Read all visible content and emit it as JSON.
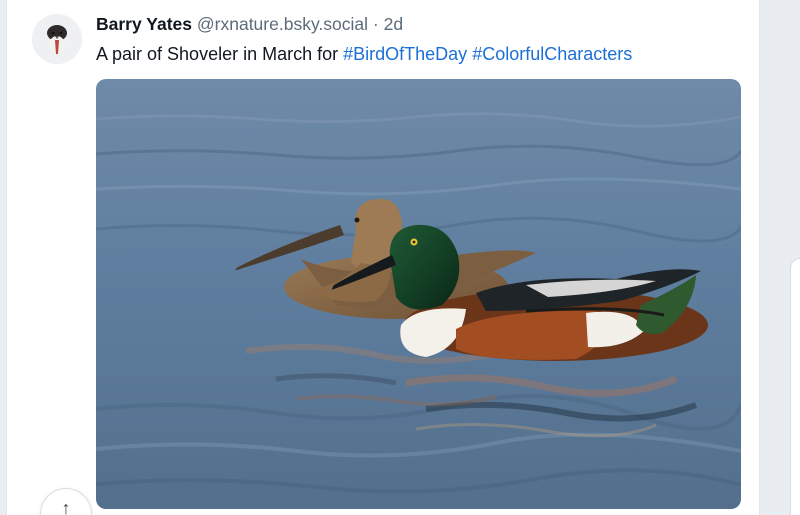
{
  "post": {
    "author_name": "Barry Yates",
    "author_handle": "@rxnature.bsky.social",
    "separator": "·",
    "time": "2d",
    "text": "A pair of Shoveler in March for ",
    "hashtags": [
      "#BirdOfTheDay",
      "#ColorfulCharacters"
    ]
  },
  "icons": {
    "avatar": "bird-avatar-icon",
    "reply": "arrow-up-icon"
  },
  "colors": {
    "hashtag": "#1b6fd6",
    "water": "#5f7f9f"
  }
}
